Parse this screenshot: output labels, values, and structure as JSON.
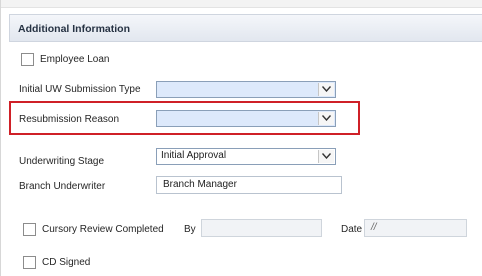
{
  "section": {
    "title": "Additional Information"
  },
  "employee_loan": {
    "label": "Employee Loan",
    "checked": false
  },
  "initial_uw_submission_type": {
    "label": "Initial UW Submission Type",
    "value": ""
  },
  "resubmission_reason": {
    "label": "Resubmission Reason",
    "value": ""
  },
  "underwriting_stage": {
    "label": "Underwriting Stage",
    "value": "Initial Approval"
  },
  "branch_underwriter": {
    "label": "Branch Underwriter",
    "value": "Branch Manager"
  },
  "cursory_review": {
    "label": "Cursory Review Completed",
    "checked": false,
    "by_label": "By",
    "by_value": "",
    "date_label": "Date",
    "date_value": "//"
  },
  "cd_signed": {
    "label": "CD Signed",
    "checked": false
  },
  "colors": {
    "highlight": "#cf2027",
    "empty_select_fill": "#dde9fb",
    "header_text": "#263243"
  }
}
